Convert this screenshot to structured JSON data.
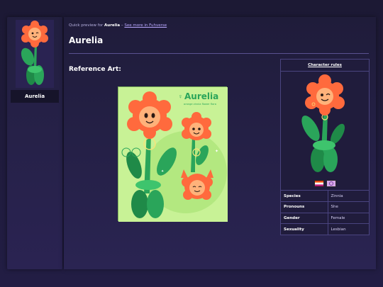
{
  "sidebar": {
    "character_name": "Aurelia"
  },
  "breadcrumb": {
    "prefix": "Quick preview for",
    "name": "Aurelia",
    "separator": "–",
    "link": "See more in Fuhverse"
  },
  "page": {
    "title": "Aurelia",
    "section_title": "Reference Art:"
  },
  "ref_art": {
    "logo_text": "Aurelia",
    "subtitle": "orange zinnia flower flora"
  },
  "panel": {
    "header_link": "Character rules",
    "flags": [
      "lesbian-flag-icon",
      "intersex-flag-icon"
    ],
    "rows": [
      {
        "key": "Species",
        "value": "Zinnia"
      },
      {
        "key": "Pronouns",
        "value": "She"
      },
      {
        "key": "Gender",
        "value": "Female"
      },
      {
        "key": "Sexuality",
        "value": "Lesbian"
      }
    ]
  },
  "colors": {
    "background": "#1a1730",
    "accent_link": "#b9a8ff",
    "flower_petal": "#ff6a3d",
    "flower_center": "#ffb27a",
    "stem_green": "#2aa55a",
    "art_bg": "#c8f296"
  }
}
